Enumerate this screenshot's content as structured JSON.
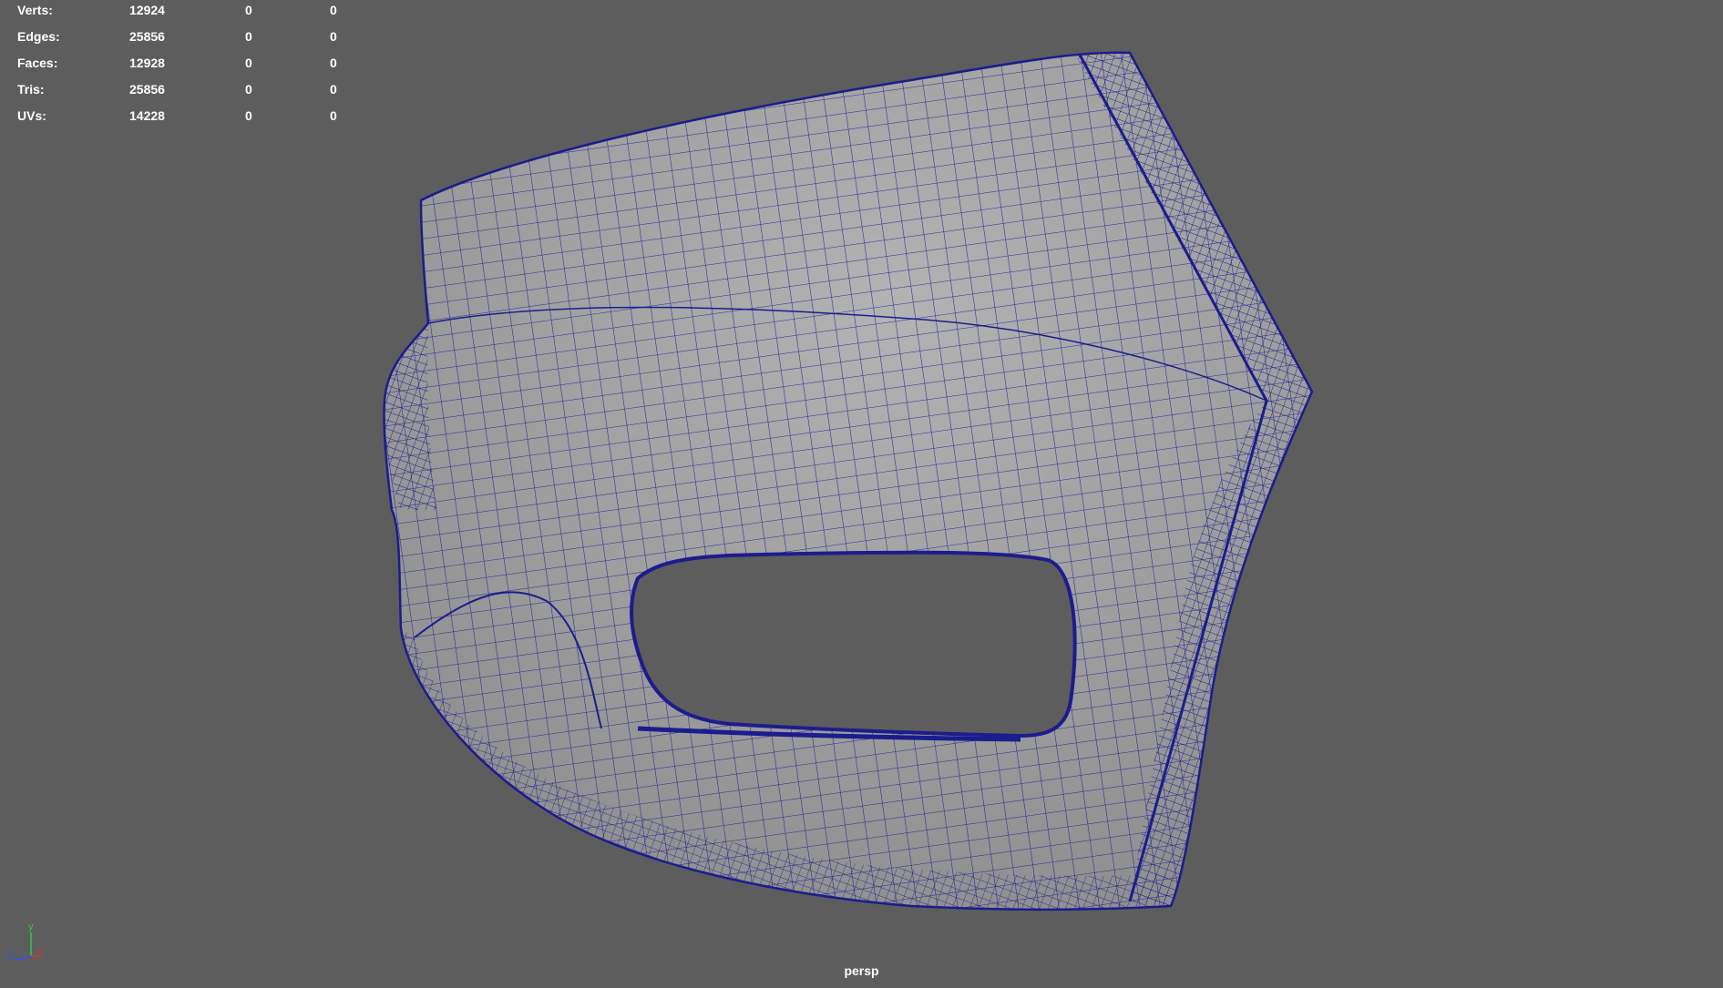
{
  "heads_up_display": {
    "poly_count": [
      {
        "label": "Verts:",
        "values": [
          "12924",
          "0",
          "0"
        ]
      },
      {
        "label": "Edges:",
        "values": [
          "25856",
          "0",
          "0"
        ]
      },
      {
        "label": "Faces:",
        "values": [
          "12928",
          "0",
          "0"
        ]
      },
      {
        "label": "Tris:",
        "values": [
          "25856",
          "0",
          "0"
        ]
      },
      {
        "label": "UVs:",
        "values": [
          "14228",
          "0",
          "0"
        ]
      }
    ]
  },
  "viewport": {
    "camera": "persp",
    "background_color": "#5d5d5d",
    "mesh_fill_color": "#a6a6a6",
    "wireframe_color": "#1c1c8e",
    "axis_gizmo": {
      "x_label": "x",
      "y_label": "y",
      "z_label": "z",
      "x_color": "#e03030",
      "y_color": "#30d030",
      "z_color": "#3050ff"
    }
  }
}
